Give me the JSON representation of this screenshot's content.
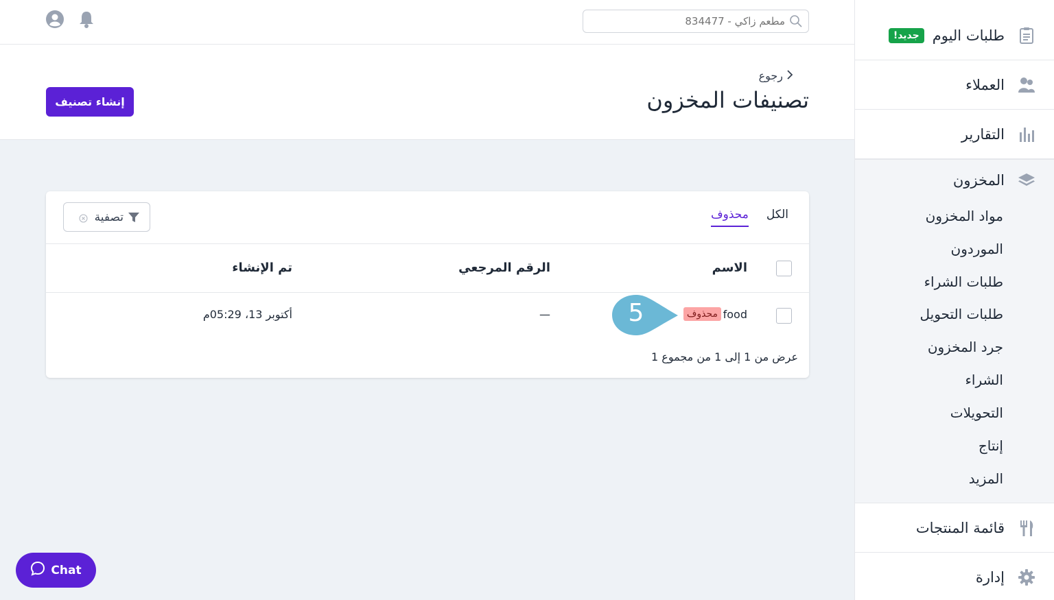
{
  "sidebar": {
    "today_orders": "طلبات اليوم",
    "new_badge": "جديد!",
    "customers": "العملاء",
    "reports": "التقارير",
    "inventory": "المخزون",
    "inventory_items": [
      "مواد المخزون",
      "الموردون",
      "طلبات الشراء",
      "طلبات التحويل",
      "جرد المخزون",
      "الشراء",
      "التحويلات",
      "إنتاج",
      "المزيد"
    ],
    "menu": "قائمة المنتجات",
    "management": "إدارة"
  },
  "topbar": {
    "search_placeholder": "مطعم زاكي - 834477"
  },
  "header": {
    "back_label": "رجوع",
    "title": "تصنيفات المخزون",
    "create_button": "إنشاء تصنيف"
  },
  "card": {
    "tabs": [
      {
        "label": "الكل",
        "active": false
      },
      {
        "label": "محذوف",
        "active": true
      }
    ],
    "filter_label": "تصفية",
    "columns": {
      "name": "الاسم",
      "reference": "الرقم المرجعي",
      "created": "تم الإنشاء"
    },
    "rows": [
      {
        "name": "food",
        "badge": "محذوف",
        "reference": "—",
        "created": "أكتوبر 13، 05:29م"
      }
    ],
    "pagination": "عرض من 1 إلى 1 من مجموع 1"
  },
  "marker": {
    "number": "5"
  },
  "chat": {
    "label": "Chat"
  },
  "colors": {
    "accent": "#5b21d6",
    "badge_new": "#16a34a",
    "badge_deleted": "#fca5a5",
    "marker": "#6bb8d6",
    "content_bg": "#eef2f6"
  }
}
